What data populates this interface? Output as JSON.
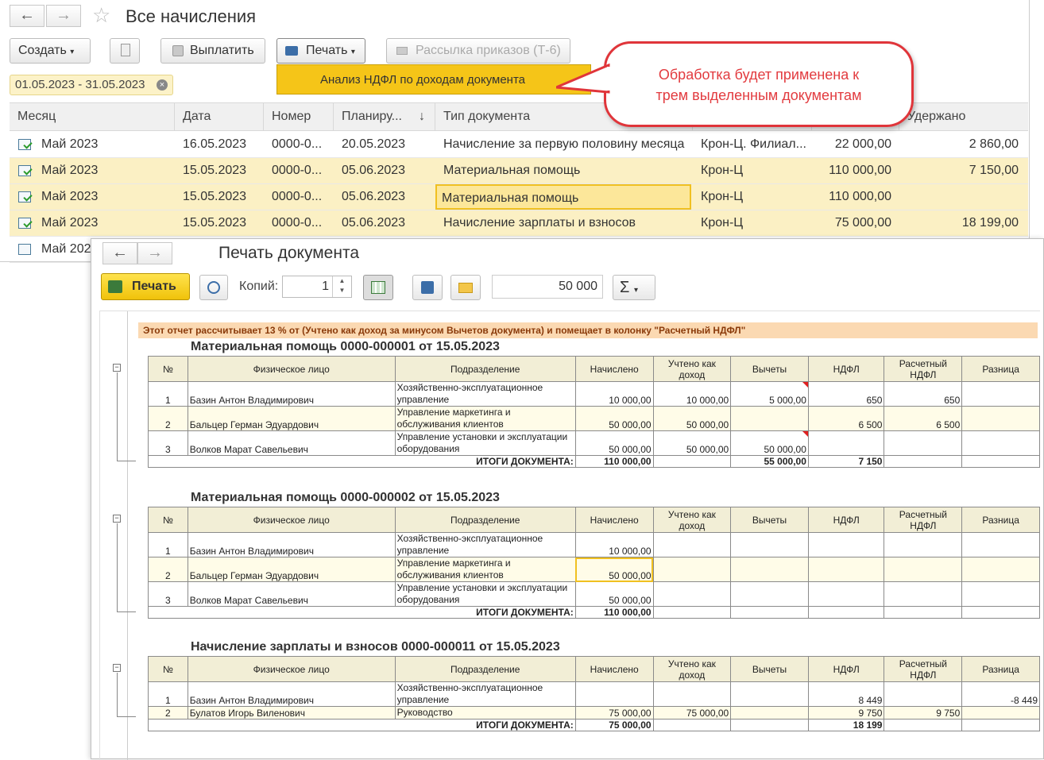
{
  "window_main": {
    "title": "Все начисления",
    "toolbar": {
      "create": "Создать",
      "pay": "Выплатить",
      "print": "Печать",
      "mailing": "Рассылка приказов (Т-6)"
    },
    "period": "01.05.2023 - 31.05.2023",
    "print_menu_item": "Анализ НДФЛ по доходам документа",
    "columns": [
      "Месяц",
      "Дата",
      "Номер",
      "Планиру...",
      "Тип документа",
      "",
      "",
      "Удержано"
    ],
    "rows": [
      {
        "month": "Май 2023",
        "date": "16.05.2023",
        "num": "0000-0...",
        "plan": "20.05.2023",
        "type": "Начисление за первую половину месяца",
        "org": "Крон-Ц. Филиал...",
        "sum": "22 000,00",
        "held": "2 860,00"
      },
      {
        "month": "Май 2023",
        "date": "15.05.2023",
        "num": "0000-0...",
        "plan": "05.06.2023",
        "type": "Материальная помощь",
        "org": "Крон-Ц",
        "sum": "110 000,00",
        "held": "7 150,00"
      },
      {
        "month": "Май 2023",
        "date": "15.05.2023",
        "num": "0000-0...",
        "plan": "05.06.2023",
        "type": "Материальная помощь",
        "org": "Крон-Ц",
        "sum": "110 000,00",
        "held": ""
      },
      {
        "month": "Май 2023",
        "date": "15.05.2023",
        "num": "0000-0...",
        "plan": "05.06.2023",
        "type": "Начисление зарплаты и взносов",
        "org": "Крон-Ц",
        "sum": "75 000,00",
        "held": "18 199,00"
      },
      {
        "month": "Май 202",
        "date": "",
        "num": "",
        "plan": "",
        "type": "",
        "org": "",
        "sum": "",
        "held": ""
      }
    ]
  },
  "callout": {
    "line1": "Обработка будет применена к",
    "line2": "трем выделенным документам"
  },
  "print_window": {
    "title": "Печать документа",
    "print_button": "Печать",
    "copies_label": "Копий:",
    "copies_value": "1",
    "sum_value": "50 000",
    "sigma": "Σ",
    "note": "Этот отчет рассчитывает 13 % от (Учтено как доход за минусом Вычетов документа)  и помещает в колонку \"Расчетный НДФЛ\"",
    "headers": [
      "№",
      "Физическое лицо",
      "Подразделение",
      "Начислено",
      "Учтено как доход",
      "Вычеты",
      "НДФЛ",
      "Расчетный НДФЛ",
      "Разница"
    ],
    "total_label": "ИТОГИ ДОКУМЕНТА:",
    "reports": [
      {
        "title": "Материальная помощь 0000-000001 от 15.05.2023",
        "rows": [
          {
            "n": "1",
            "person": "Базин Антон Владимирович",
            "dept1": "Хозяйственно-эксплуатационное",
            "dept2": "управление",
            "accr": "10 000,00",
            "income": "10 000,00",
            "ded": "5 000,00",
            "ndfl": "650",
            "calc": "650",
            "diff": ""
          },
          {
            "n": "2",
            "person": "Бальцер Герман Эдуардович",
            "dept1": "Управление маркетинга и",
            "dept2": "обслуживания клиентов",
            "accr": "50 000,00",
            "income": "50 000,00",
            "ded": "",
            "ndfl": "6 500",
            "calc": "6 500",
            "diff": ""
          },
          {
            "n": "3",
            "person": "Волков Марат Савельевич",
            "dept1": "Управление установки и эксплуатации",
            "dept2": "оборудования",
            "accr": "50 000,00",
            "income": "50 000,00",
            "ded": "50 000,00",
            "ndfl": "",
            "calc": "",
            "diff": ""
          }
        ],
        "total": {
          "accr": "110 000,00",
          "income": "",
          "ded": "55 000,00",
          "ndfl": "7 150",
          "calc": "",
          "diff": ""
        }
      },
      {
        "title": "Материальная помощь 0000-000002 от 15.05.2023",
        "rows": [
          {
            "n": "1",
            "person": "Базин Антон Владимирович",
            "dept1": "Хозяйственно-эксплуатационное",
            "dept2": "управление",
            "accr": "10 000,00",
            "income": "",
            "ded": "",
            "ndfl": "",
            "calc": "",
            "diff": ""
          },
          {
            "n": "2",
            "person": "Бальцер Герман Эдуардович",
            "dept1": "Управление маркетинга и",
            "dept2": "обслуживания клиентов",
            "accr": "50 000,00",
            "income": "",
            "ded": "",
            "ndfl": "",
            "calc": "",
            "diff": ""
          },
          {
            "n": "3",
            "person": "Волков Марат Савельевич",
            "dept1": "Управление установки и эксплуатации",
            "dept2": "оборудования",
            "accr": "50 000,00",
            "income": "",
            "ded": "",
            "ndfl": "",
            "calc": "",
            "diff": ""
          }
        ],
        "total": {
          "accr": "110 000,00",
          "income": "",
          "ded": "",
          "ndfl": "",
          "calc": "",
          "diff": ""
        }
      },
      {
        "title": "Начисление зарплаты и взносов 0000-000011 от 15.05.2023",
        "rows": [
          {
            "n": "1",
            "person": "Базин Антон Владимирович",
            "dept1": "Хозяйственно-эксплуатационное",
            "dept2": "управление",
            "accr": "",
            "income": "",
            "ded": "",
            "ndfl": "8 449",
            "calc": "",
            "diff": "-8 449"
          },
          {
            "n": "2",
            "person": "Булатов Игорь Виленович",
            "dept1": "",
            "dept2": "Руководство",
            "accr": "75 000,00",
            "income": "75 000,00",
            "ded": "",
            "ndfl": "9 750",
            "calc": "9 750",
            "diff": ""
          }
        ],
        "total": {
          "accr": "75 000,00",
          "income": "",
          "ded": "",
          "ndfl": "18 199",
          "calc": "",
          "diff": ""
        }
      }
    ]
  }
}
